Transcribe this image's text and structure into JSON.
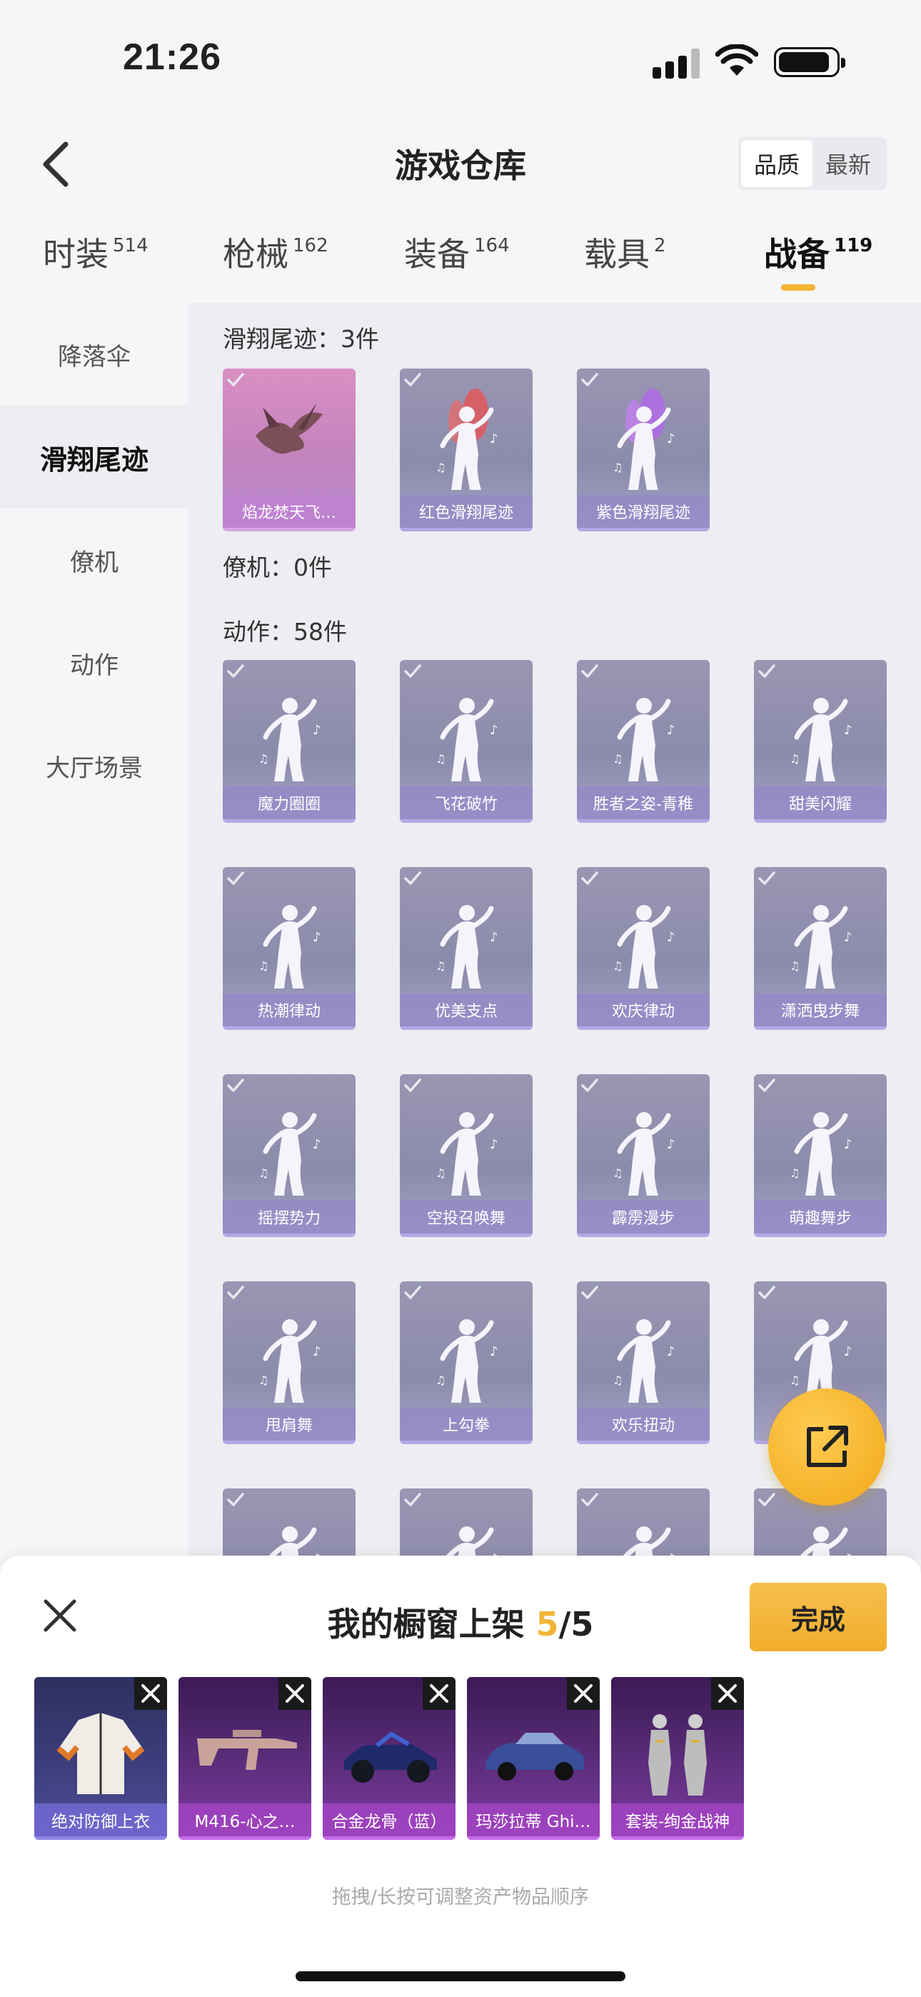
{
  "status": {
    "time": "21:26"
  },
  "header": {
    "title": "游戏仓库",
    "sort_options": [
      "品质",
      "最新"
    ]
  },
  "tabs": [
    {
      "label": "时装",
      "count": "514"
    },
    {
      "label": "枪械",
      "count": "162"
    },
    {
      "label": "装备",
      "count": "164"
    },
    {
      "label": "载具",
      "count": "2"
    },
    {
      "label": "战备",
      "count": "119"
    }
  ],
  "sidebar": {
    "items": [
      "降落伞",
      "滑翔尾迹",
      "僚机",
      "动作",
      "大厅场景"
    ]
  },
  "sections": {
    "trails_title": "滑翔尾迹：3件",
    "wingman_title": "僚机：0件",
    "actions_title": "动作：58件"
  },
  "trails": [
    "焰龙焚天飞…",
    "红色滑翔尾迹",
    "紫色滑翔尾迹"
  ],
  "actions": [
    "魔力圈圈",
    "飞花破竹",
    "胜者之姿-青稚",
    "甜美闪耀",
    "热潮律动",
    "优美支点",
    "欢庆律动",
    "潇洒曳步舞",
    "摇摆势力",
    "空投召唤舞",
    "霹雳漫步",
    "萌趣舞步",
    "甩肩舞",
    "上勾拳",
    "欢乐扭动",
    "",
    "",
    "",
    "",
    ""
  ],
  "sheet": {
    "title_prefix": "我的橱窗上架 ",
    "count": "5",
    "total": "/5",
    "done_label": "完成",
    "items": [
      "绝对防御上衣",
      "M416-心之…",
      "合金龙骨（蓝）",
      "玛莎拉蒂 Ghi…",
      "套装-绚金战神"
    ],
    "hint": "拖拽/长按可调整资产物品顺序"
  },
  "colors": {
    "accent": "#f2b434",
    "card_purple": "#9896b2",
    "card_pink": "#d98fc3"
  }
}
